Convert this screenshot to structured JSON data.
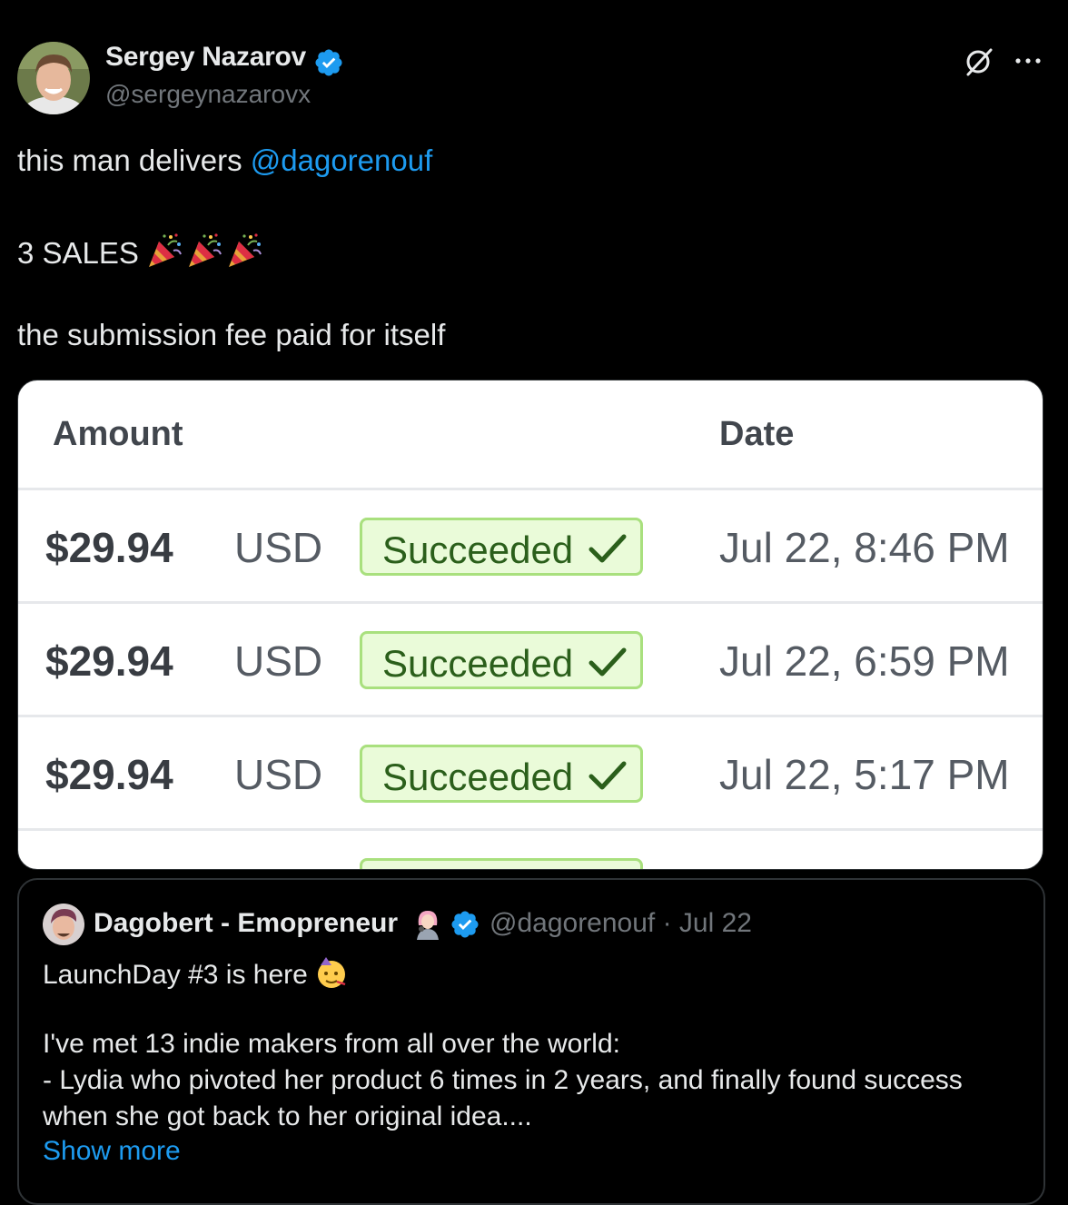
{
  "author": {
    "name": "Sergey Nazarov",
    "handle": "@sergeynazarovx"
  },
  "tweet": {
    "line1_text": "this man delivers ",
    "mention": "@dagorenouf",
    "line2_text": "3 SALES",
    "line2_emoji": "party-popper-icon x3",
    "line3_text": "the submission fee paid for itself"
  },
  "media": {
    "headers": {
      "amount": "Amount",
      "date": "Date"
    },
    "rows": [
      {
        "amount": "$29.94",
        "currency": "USD",
        "status": "Succeeded",
        "date": "Jul 22, 8:46 PM"
      },
      {
        "amount": "$29.94",
        "currency": "USD",
        "status": "Succeeded",
        "date": "Jul 22, 6:59 PM"
      },
      {
        "amount": "$29.94",
        "currency": "USD",
        "status": "Succeeded",
        "date": "Jul 22, 5:17 PM"
      }
    ],
    "colors": {
      "badge_border": "#a9e07e",
      "badge_bg": "#eafbd9",
      "badge_text": "#2b5f1b"
    }
  },
  "quote": {
    "name": "Dagobert - Emopreneur",
    "meta": "@dagorenouf · Jul 22",
    "line1": "LaunchDay #3 is here",
    "line2": "I've met 13 indie makers from all over the world:",
    "line3": "- Lydia who pivoted her product 6 times in 2 years, and finally found success",
    "line4": "when she got back to her original idea....",
    "show_more": "Show more"
  },
  "colors": {
    "background": "#000000",
    "text": "#e7e9ea",
    "secondary": "#71767b",
    "link": "#1d9bf0",
    "verified": "#1d9bf0"
  }
}
